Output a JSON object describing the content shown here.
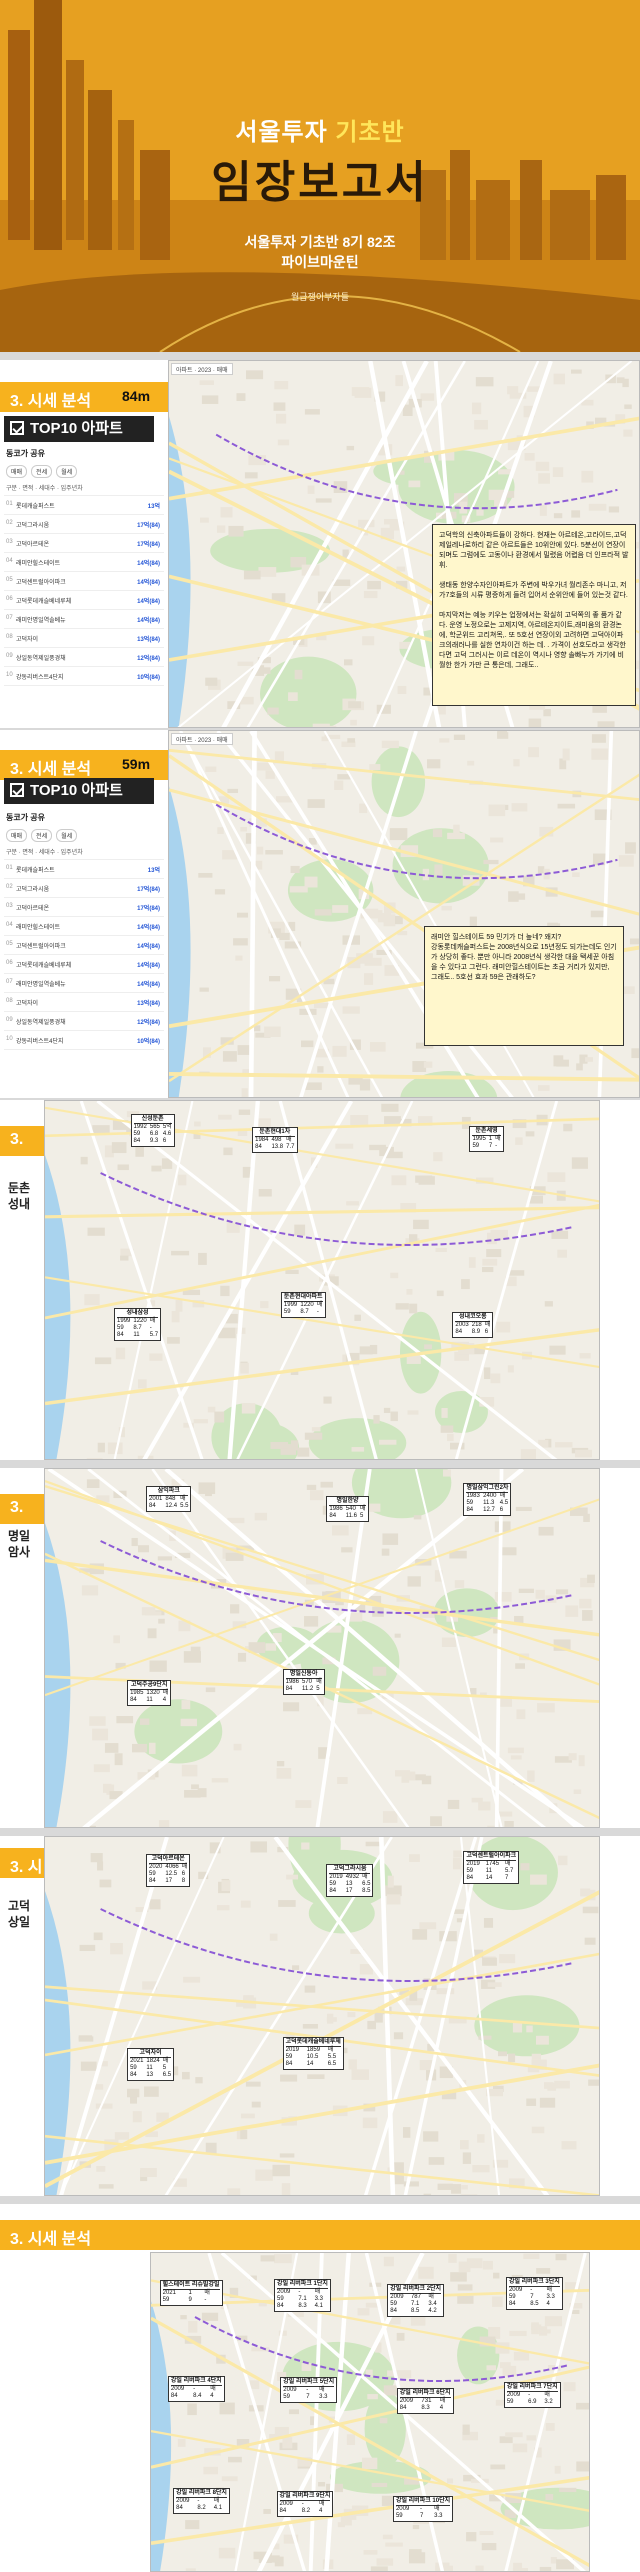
{
  "cover": {
    "title_prefix": "서울투자",
    "title_highlight": "기초반",
    "main_title": "임장보고서",
    "subtitle_line1": "서울투자 기초반 8기 82조",
    "subtitle_line2": "파이브마운틴",
    "footer": "월급쟁이부자들"
  },
  "section_title": "3. 시세 분석",
  "slides": [
    {
      "size": "84m",
      "top10": "TOP10 아파트",
      "note": "고덕학의 신축아파트들이 강하다. 현재는 아르테온,고라이드,고덕제일레나로하리 같은 아르트들은 10위안에 있다. 5분선이 연장이 되며도 그럼에도 고동이나 환경에서 밀렸음 어렵음 더 인프라적 발휘.\n\n생태동 한양수자인아파트가 주변에 박우가녀 월리존수 마니고, 저가7호들의 시류 평증하게 들려 입어서 순위안에 들어 있는것 같다.\n\n마지막저는 예능 키우는 업정에서는 확실히 고덕쪽의 좋 품가 같다. 운영 노정으로는 고제지역, 아르테온지이트,래미움의 환경논에, 학군위드 고리쳐목,. 또 5호선 연장이외 고려하면 고덕아이파크의래러나를 실한 연차이건 하는 데. . 가격이 선호도라고 생각한다면 고덕 그러시는 이르 데온이 역시나 영향 솔빠누가 가기에 비월한 한가 가만 큰 통은데, 그래도.."
    },
    {
      "size": "59m",
      "top10": "TOP10 아파트",
      "note": "래미안 힐스테이트 59 민기가 더 높네? 왜지?\n강동롯데캐슬퍼스트는 2008년식으로 15년정도 되가는데도 인기가 상당히 좋다. 뿐만 아니라 2008년식 생각한 대을 택세꾼 아침을 수 있다고 그런다. 래미안힐스테이트는 초금 거리가 있지만, 그래도.. 5호선 효과 59은 관래하도?"
    }
  ],
  "list_rows": [
    {
      "rank": "01",
      "name": "롯데캐슬퍼스트",
      "price": "13억"
    },
    {
      "rank": "02",
      "name": "고덕그라시움",
      "price": "17억(84)"
    },
    {
      "rank": "03",
      "name": "고덕아르테온",
      "price": "17억(84)"
    },
    {
      "rank": "04",
      "name": "래미안힐스테이트",
      "price": "14억(84)"
    },
    {
      "rank": "05",
      "name": "고덕센트럴아이파크",
      "price": "14억(84)"
    },
    {
      "rank": "06",
      "name": "고덕롯데캐슬베네루체",
      "price": "14억(84)"
    },
    {
      "rank": "07",
      "name": "래미안명일역솔베뉴",
      "price": "14억(84)"
    },
    {
      "rank": "08",
      "name": "고덕자이",
      "price": "13억(84)"
    },
    {
      "rank": "09",
      "name": "상일동역제일풍경채",
      "price": "12억(84)"
    },
    {
      "rank": "10",
      "name": "강동리버스트4단지",
      "price": "10억(84)"
    }
  ],
  "list_panel": {
    "header": "동코가 공유",
    "tab1": "매매",
    "tab2": "전세",
    "tab3": "월세",
    "filter": "구분 · 면적 · 세대수 · 입주년차"
  },
  "map_bar": "아파트 · 2023 · 매매",
  "side_captions": {
    "s3": "둔촌\n성내",
    "s4": "명일\n암사",
    "s5": "고덕\n상일"
  },
  "price_boxes_s3": [
    {
      "name": "신성둔촌",
      "rows": [
        "1992",
        "565",
        "5억",
        "59",
        "6.8",
        "4.6",
        "84",
        "9.3",
        "6"
      ]
    },
    {
      "name": "둔촌현대1차",
      "rows": [
        "1984",
        "498",
        "매",
        "84",
        "13.8",
        "7.7"
      ]
    },
    {
      "name": "둔촌세영",
      "rows": [
        "1995",
        "1",
        "매",
        "59",
        "7",
        "-"
      ]
    },
    {
      "name": "성내삼성",
      "rows": [
        "1999",
        "1220",
        "매",
        "59",
        "8.7",
        "-",
        "84",
        "11",
        "5.7"
      ]
    },
    {
      "name": "둔촌현대아파트",
      "rows": [
        "1999",
        "1220",
        "매",
        "59",
        "8.7",
        "-"
      ]
    },
    {
      "name": "성내코오롱",
      "rows": [
        "2003",
        "218",
        "매",
        "84",
        "8.9",
        "6"
      ]
    }
  ],
  "price_boxes_s4": [
    {
      "name": "삼익파크",
      "rows": [
        "2001",
        "848",
        "매",
        "84",
        "12.4",
        "5.5"
      ]
    },
    {
      "name": "명일한양",
      "rows": [
        "1986",
        "540",
        "매",
        "84",
        "11.6",
        "5"
      ]
    },
    {
      "name": "명일삼익그린2차",
      "rows": [
        "1983",
        "2400",
        "매",
        "59",
        "11.3",
        "4.5",
        "84",
        "12.7",
        "6"
      ]
    },
    {
      "name": "고덕주공9단지",
      "rows": [
        "1985",
        "1320",
        "매",
        "84",
        "11",
        "4"
      ]
    },
    {
      "name": "명일신동아",
      "rows": [
        "1986",
        "570",
        "매",
        "84",
        "11.2",
        "5"
      ]
    }
  ],
  "price_boxes_s5": [
    {
      "name": "고덕아르테온",
      "rows": [
        "2020",
        "4066",
        "매",
        "59",
        "12.5",
        "6",
        "84",
        "17",
        "8"
      ]
    },
    {
      "name": "고덕그라시움",
      "rows": [
        "2019",
        "4932",
        "매",
        "59",
        "13",
        "6.5",
        "84",
        "17",
        "8.5"
      ]
    },
    {
      "name": "고덕센트럴아이파크",
      "rows": [
        "2019",
        "1745",
        "매",
        "59",
        "11",
        "5.7",
        "84",
        "14",
        "7"
      ]
    },
    {
      "name": "고덕자이",
      "rows": [
        "2021",
        "1824",
        "매",
        "59",
        "11",
        "5",
        "84",
        "13",
        "6.5"
      ]
    },
    {
      "name": "고덕롯데캐슬베네루체",
      "rows": [
        "2019",
        "1859",
        "매",
        "59",
        "10.5",
        "5.5",
        "84",
        "14",
        "6.5"
      ]
    }
  ],
  "price_boxes_s6": [
    {
      "name": "힐스테이트 리슈빌강일",
      "rows": [
        "2021",
        "1",
        "매",
        "59",
        "9",
        "-"
      ]
    },
    {
      "name": "강일 리버파크 1단지",
      "rows": [
        "2009",
        "-",
        "매",
        "59",
        "7.1",
        "3.3",
        "84",
        "8.3",
        "4.1"
      ]
    },
    {
      "name": "강일 리버파크 2단지",
      "rows": [
        "2009",
        "787",
        "매",
        "59",
        "7.1",
        "3.4",
        "84",
        "8.5",
        "4.2"
      ]
    },
    {
      "name": "강일 리버파크 3단지",
      "rows": [
        "2009",
        "-",
        "매",
        "59",
        "7",
        "3.3",
        "84",
        "8.5",
        "4"
      ]
    },
    {
      "name": "강일 리버파크 4단지",
      "rows": [
        "2009",
        "-",
        "매",
        "84",
        "8.4",
        "4"
      ]
    },
    {
      "name": "강일 리버파크 5단지",
      "rows": [
        "2009",
        "-",
        "매",
        "59",
        "7",
        "3.3"
      ]
    },
    {
      "name": "강일 리버파크 6단지",
      "rows": [
        "2009",
        "731",
        "매",
        "84",
        "8.3",
        "4"
      ]
    },
    {
      "name": "강일 리버파크 7단지",
      "rows": [
        "2009",
        "-",
        "매",
        "59",
        "6.9",
        "3.2"
      ]
    },
    {
      "name": "강일 리버파크 8단지",
      "rows": [
        "2009",
        "-",
        "매",
        "84",
        "8.2",
        "4.1"
      ]
    },
    {
      "name": "강일 리버파크 9단지",
      "rows": [
        "2009",
        "-",
        "매",
        "84",
        "8.2",
        "4"
      ]
    },
    {
      "name": "강일 리버파크 10단지",
      "rows": [
        "2009",
        "-",
        "매",
        "59",
        "7",
        "3.3"
      ]
    }
  ],
  "colors": {
    "accent": "#f7b21e",
    "cover_dark": "#2a1a08",
    "note_bg": "#fff7cc"
  }
}
